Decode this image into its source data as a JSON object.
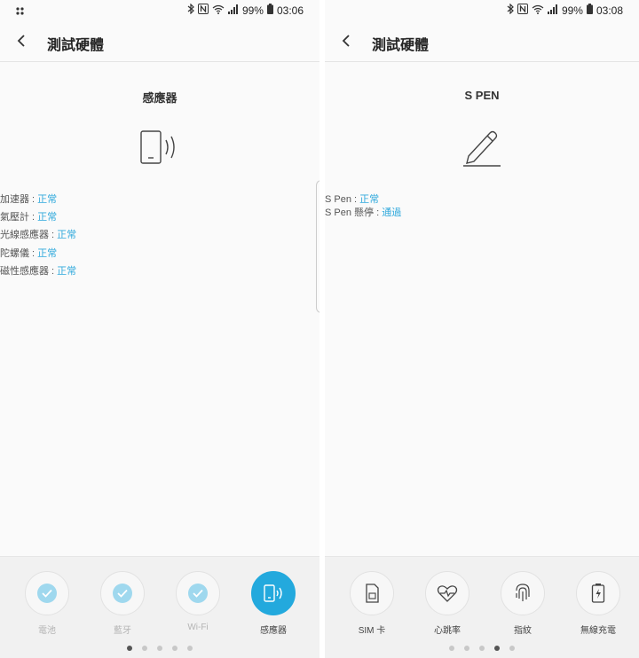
{
  "left": {
    "status": {
      "battery": "99%",
      "time": "03:06"
    },
    "header": {
      "title": "測試硬體"
    },
    "section_title": "感應器",
    "results": [
      {
        "label": "加速器 : ",
        "value": "正常"
      },
      {
        "label": "氣壓計 : ",
        "value": "正常"
      },
      {
        "label": "光線感應器 : ",
        "value": "正常"
      },
      {
        "label": "陀螺儀 : ",
        "value": "正常"
      },
      {
        "label": "磁性感應器 : ",
        "value": "正常"
      }
    ],
    "tools": [
      {
        "label": "電池",
        "state": "done"
      },
      {
        "label": "藍牙",
        "state": "done"
      },
      {
        "label": "Wi-Fi",
        "state": "done"
      },
      {
        "label": "感應器",
        "state": "active"
      }
    ],
    "page_dots": {
      "count": 5,
      "active": 1
    }
  },
  "right": {
    "status": {
      "battery": "99%",
      "time": "03:08"
    },
    "header": {
      "title": "測試硬體"
    },
    "section_title": "S PEN",
    "results": [
      {
        "label": "S Pen : ",
        "value": "正常"
      },
      {
        "label": "S Pen 懸停 : ",
        "value": "通過"
      }
    ],
    "tools": [
      {
        "label": "SIM 卡",
        "icon": "sim-card-icon"
      },
      {
        "label": "心跳率",
        "icon": "heart-rate-icon"
      },
      {
        "label": "指紋",
        "icon": "fingerprint-icon"
      },
      {
        "label": "無線充電",
        "icon": "wireless-charging-icon"
      }
    ],
    "page_dots": {
      "count": 5,
      "active": 4
    }
  },
  "colors": {
    "accent": "#23a9dd",
    "ok_text": "#30a9dc",
    "done_check": "#9fd8ee"
  }
}
